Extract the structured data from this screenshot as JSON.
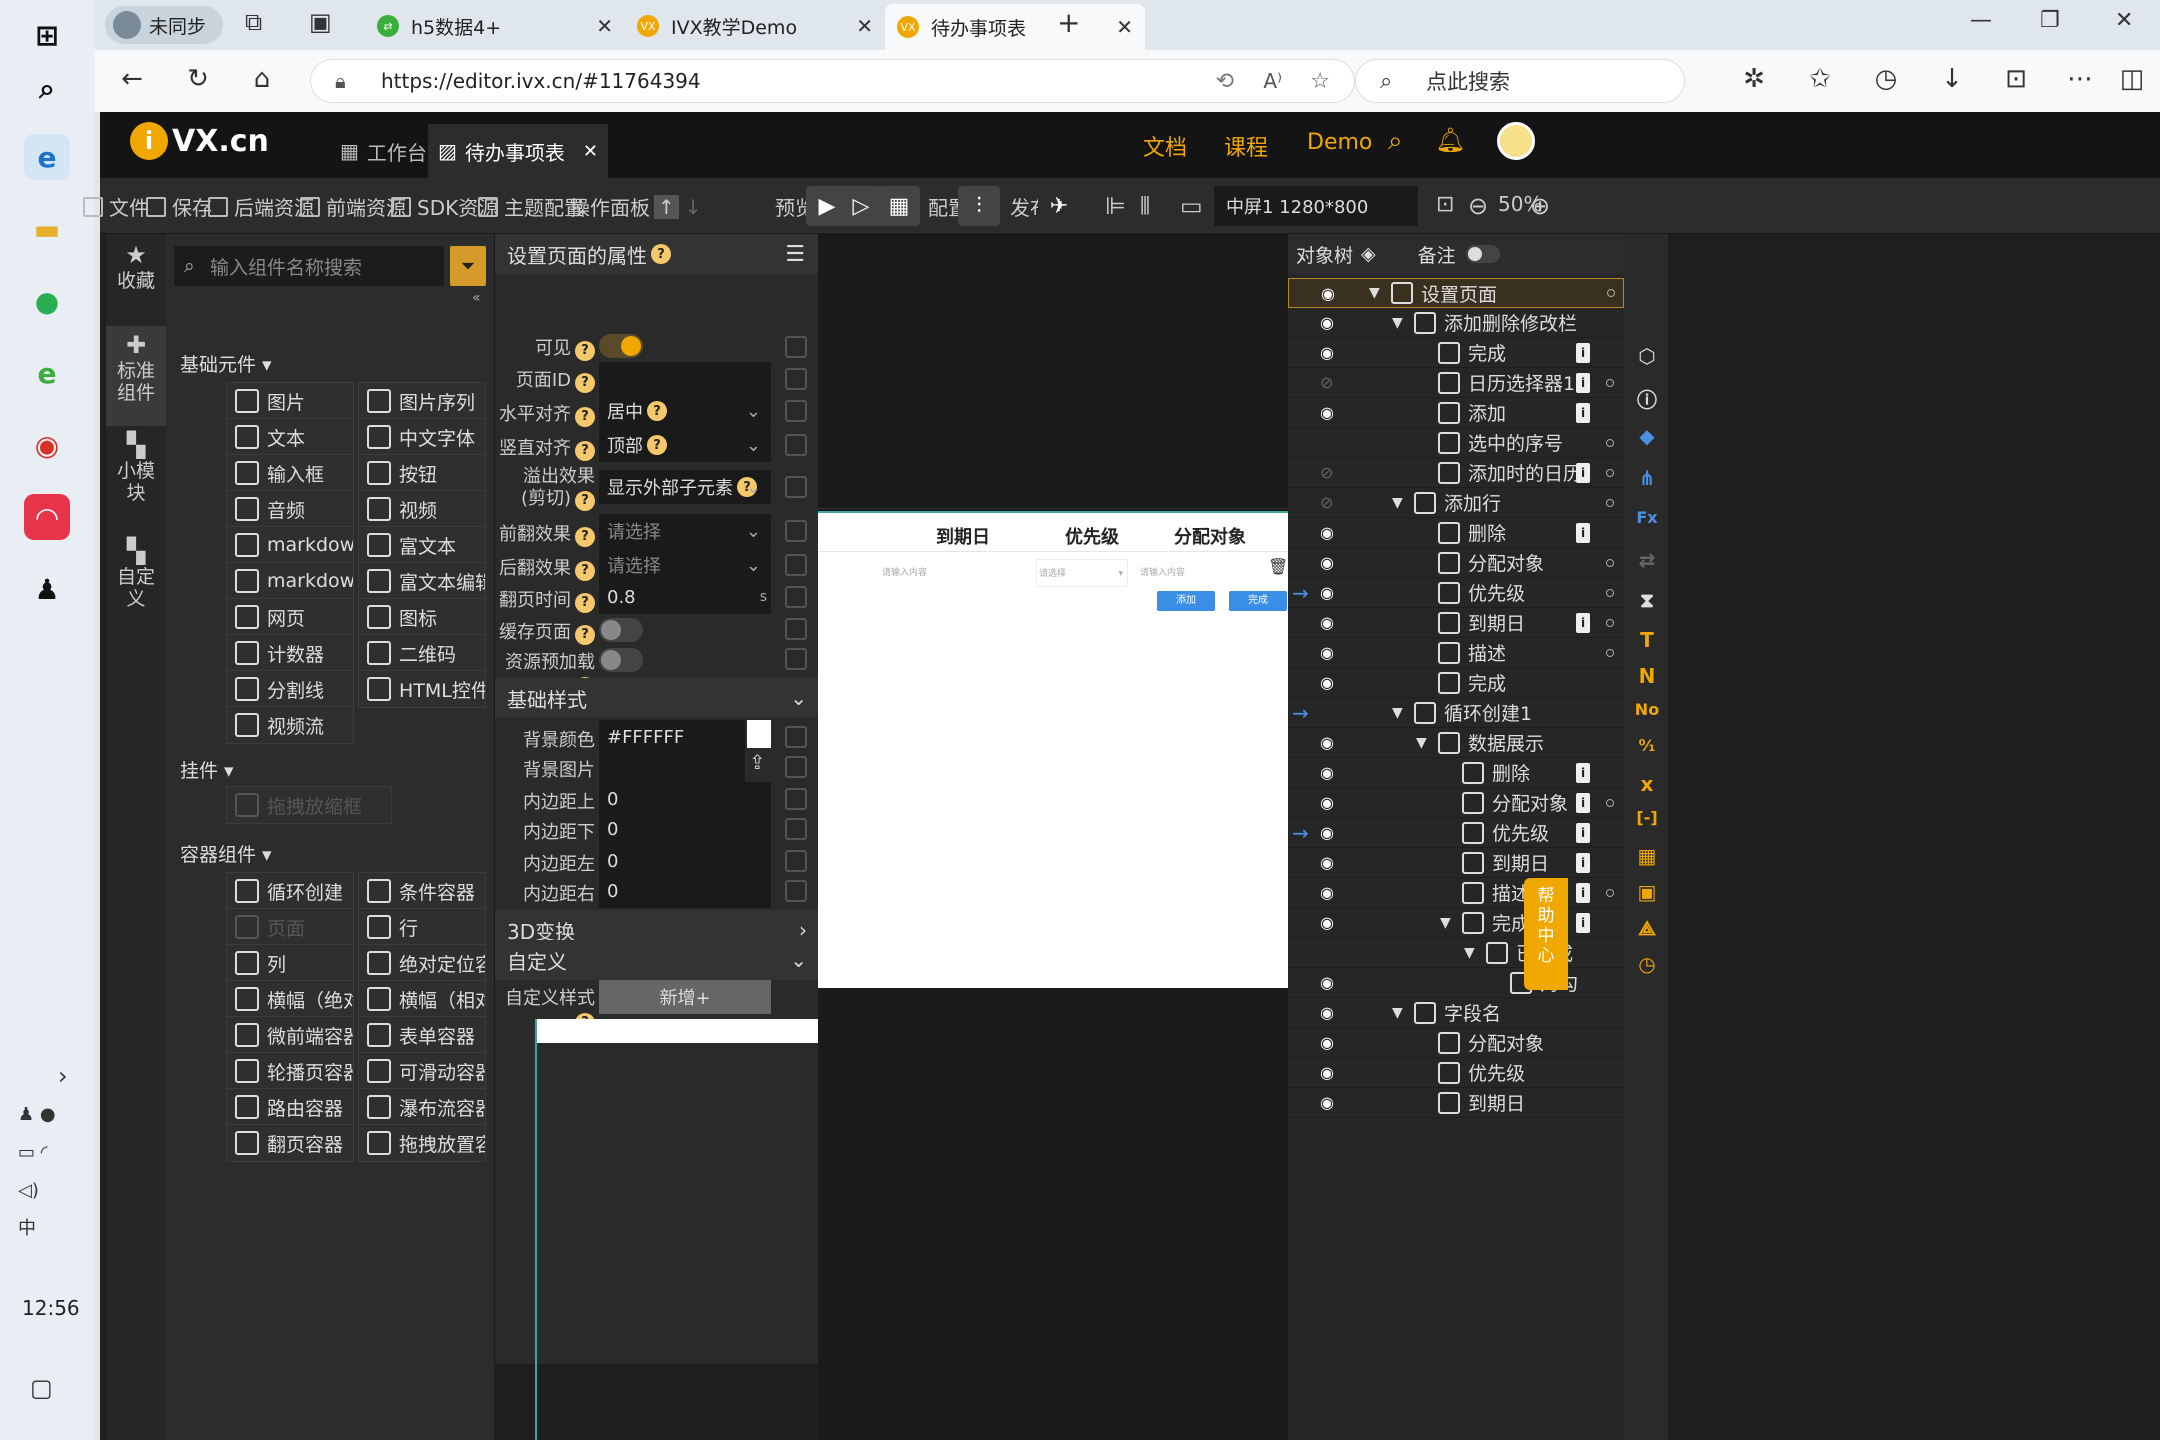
{
  "taskbar": {
    "time": "12:56"
  },
  "browser": {
    "profile_label": "未同步",
    "tabs": [
      {
        "title": "h5数据4+"
      },
      {
        "title": "IVX教学Demo"
      },
      {
        "title": "待办事项表"
      }
    ],
    "url": "https://editor.ivx.cn/#11764394",
    "search_placeholder": "点此搜索"
  },
  "app": {
    "logo": "VX.cn",
    "tabs": [
      {
        "label": "工作台"
      },
      {
        "label": "待办事项表"
      }
    ],
    "nav": {
      "docs": "文档",
      "course": "课程",
      "demo": "Demo"
    },
    "toolbar": {
      "file": "文件",
      "save": "保存",
      "backend": "后端资源",
      "frontend": "前端资源",
      "sdk": "SDK资源",
      "theme": "主题配置",
      "ops": "操作面板",
      "preview": "预览",
      "config": "配置",
      "publish": "发布",
      "screen": "中屏1 1280*800",
      "zoom": "50%"
    },
    "left_nav": [
      {
        "label": "收藏"
      },
      {
        "label": "标准组件"
      },
      {
        "label": "小模块"
      },
      {
        "label": "自定义"
      }
    ],
    "component_search": "输入组件名称搜索",
    "groups": {
      "basic": "基础元件",
      "plugin": "挂件",
      "container": "容器组件"
    },
    "basic_items": [
      {
        "label": "图片"
      },
      {
        "label": "图片序列"
      },
      {
        "label": "文本"
      },
      {
        "label": "中文字体"
      },
      {
        "label": "输入框"
      },
      {
        "label": "按钮"
      },
      {
        "label": "音频"
      },
      {
        "label": "视频"
      },
      {
        "label": "markdown"
      },
      {
        "label": "富文本"
      },
      {
        "label": "markdown..."
      },
      {
        "label": "富文本编辑器"
      },
      {
        "label": "网页"
      },
      {
        "label": "图标"
      },
      {
        "label": "计数器"
      },
      {
        "label": "二维码"
      },
      {
        "label": "分割线"
      },
      {
        "label": "HTML控件"
      },
      {
        "label": "视频流"
      }
    ],
    "plugin_items": [
      {
        "label": "拖拽放缩框"
      }
    ],
    "container_items": [
      {
        "label": "循环创建"
      },
      {
        "label": "条件容器"
      },
      {
        "label": "页面"
      },
      {
        "label": "行"
      },
      {
        "label": "列"
      },
      {
        "label": "绝对定位容器"
      },
      {
        "label": "横幅（绝对..."
      },
      {
        "label": "横幅（相对..."
      },
      {
        "label": "微前端容器"
      },
      {
        "label": "表单容器"
      },
      {
        "label": "轮播页容器"
      },
      {
        "label": "可滑动容器"
      },
      {
        "label": "路由容器"
      },
      {
        "label": "瀑布流容器"
      },
      {
        "label": "翻页容器"
      },
      {
        "label": "拖拽放置容器"
      }
    ],
    "props": {
      "title": "设置页面的属性",
      "visible": "可见",
      "page_id": "页面ID",
      "h_align": "水平对齐",
      "h_align_val": "居中",
      "v_align": "竖直对齐",
      "v_align_val": "顶部",
      "overflow": "溢出效果",
      "overflow_sub": "(剪切)",
      "overflow_val": "显示外部子元素",
      "front_flip": "前翻效果",
      "back_flip": "后翻效果",
      "select_ph": "请选择",
      "flip_time": "翻页时间",
      "flip_time_val": "0.8",
      "unit": "s",
      "cache": "缓存页面",
      "preload": "资源预加载",
      "basic_style": "基础样式",
      "bg_color": "背景颜色",
      "bg_color_val": "#FFFFFF",
      "bg_image": "背景图片",
      "pad_top": "内边距上",
      "pad_bottom": "内边距下",
      "pad_left": "内边距左",
      "pad_right": "内边距右",
      "pad_val": "0",
      "transform3d": "3D变换",
      "custom": "自定义",
      "custom_style": "自定义样式",
      "add_new": "新增+"
    },
    "canvas": {
      "col_due": "到期日",
      "col_priority": "优先级",
      "col_assignee": "分配对象",
      "input_ph": "请输入内容",
      "select_ph": "请选择",
      "btn_add": "添加",
      "btn_done": "完成"
    },
    "tree_header": {
      "title": "对象树",
      "notes": "备注"
    },
    "tree": [
      {
        "label": "设置页面"
      },
      {
        "label": "添加删除修改栏"
      },
      {
        "label": "完成"
      },
      {
        "label": "日历选择器1"
      },
      {
        "label": "添加"
      },
      {
        "label": "选中的序号"
      },
      {
        "label": "添加时的日历"
      },
      {
        "label": "添加行"
      },
      {
        "label": "删除"
      },
      {
        "label": "分配对象"
      },
      {
        "label": "优先级"
      },
      {
        "label": "到期日"
      },
      {
        "label": "描述"
      },
      {
        "label": "完成"
      },
      {
        "label": "循环创建1"
      },
      {
        "label": "数据展示"
      },
      {
        "label": "删除"
      },
      {
        "label": "分配对象"
      },
      {
        "label": "优先级"
      },
      {
        "label": "到期日"
      },
      {
        "label": "描述"
      },
      {
        "label": "完成"
      },
      {
        "label": "已完成"
      },
      {
        "label": "对勾"
      },
      {
        "label": "字段名"
      },
      {
        "label": "分配对象"
      },
      {
        "label": "优先级"
      },
      {
        "label": "到期日"
      }
    ],
    "help": "帮助中心"
  }
}
